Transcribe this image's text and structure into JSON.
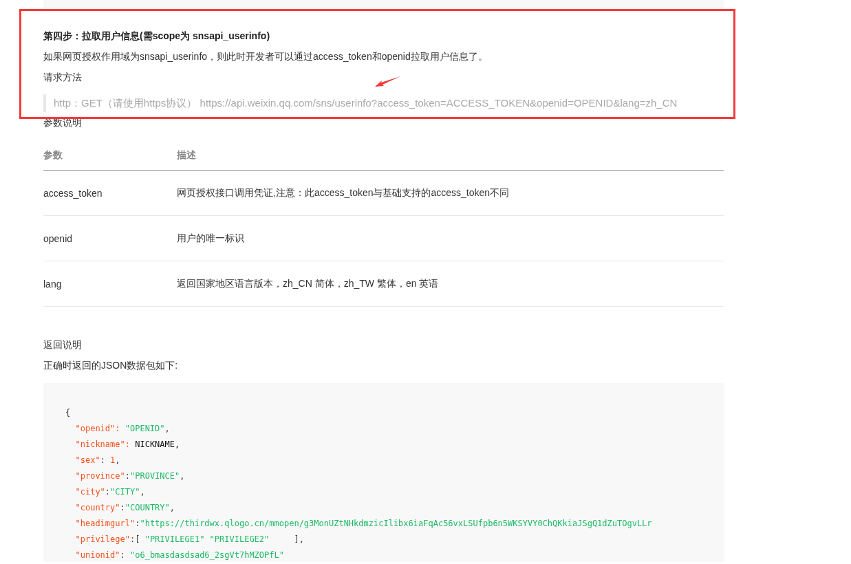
{
  "step": {
    "heading": "第四步：拉取用户信息(需scope为 snsapi_userinfo)",
    "description": "如果网页授权作用域为snsapi_userinfo，则此时开发者可以通过access_token和openid拉取用户信息了。",
    "method_label": "请求方法",
    "request": "http：GET（请使用https协议） https://api.weixin.qq.com/sns/userinfo?access_token=ACCESS_TOKEN&openid=OPENID&lang=zh_CN"
  },
  "params": {
    "title": "参数说明",
    "columns": [
      "参数",
      "描述"
    ],
    "rows": [
      [
        "access_token",
        "网页授权接口调用凭证,注意：此access_token与基础支持的access_token不同"
      ],
      [
        "openid",
        "用户的唯一标识"
      ],
      [
        "lang",
        "返回国家地区语言版本，zh_CN 简体，zh_TW 繁体，en 英语"
      ]
    ]
  },
  "response": {
    "title": "返回说明",
    "intro": "正确时返回的JSON数据包如下:",
    "code": [
      {
        "tokens": [
          {
            "kind": "punct",
            "text": "{"
          }
        ],
        "children": [
          {
            "tokens": [
              {
                "kind": "key",
                "text": "\"openid\": "
              },
              {
                "kind": "string",
                "text": "\"OPENID\""
              },
              {
                "kind": "punct",
                "text": ","
              }
            ]
          },
          {
            "tokens": [
              {
                "kind": "key",
                "text": "\"nickname\": "
              },
              {
                "kind": "plain",
                "text": "NICKNAME,"
              }
            ]
          },
          {
            "tokens": [
              {
                "kind": "key",
                "text": "\"sex\""
              },
              {
                "kind": "punct",
                "text": ": "
              },
              {
                "kind": "number",
                "text": "1"
              },
              {
                "kind": "punct",
                "text": ","
              }
            ]
          },
          {
            "tokens": [
              {
                "kind": "key",
                "text": "\"province\""
              },
              {
                "kind": "punct",
                "text": ":"
              },
              {
                "kind": "string",
                "text": "\"PROVINCE\""
              },
              {
                "kind": "punct",
                "text": ","
              }
            ]
          },
          {
            "tokens": [
              {
                "kind": "key",
                "text": "\"city\""
              },
              {
                "kind": "punct",
                "text": ":"
              },
              {
                "kind": "string",
                "text": "\"CITY\""
              },
              {
                "kind": "punct",
                "text": ","
              }
            ]
          },
          {
            "tokens": [
              {
                "kind": "key",
                "text": "\"country\""
              },
              {
                "kind": "punct",
                "text": ":"
              },
              {
                "kind": "string",
                "text": "\"COUNTRY\""
              },
              {
                "kind": "punct",
                "text": ","
              }
            ]
          },
          {
            "tokens": [
              {
                "kind": "key",
                "text": "\"headimgurl\""
              },
              {
                "kind": "punct",
                "text": ":"
              },
              {
                "kind": "string",
                "text": "\"https://thirdwx.qlogo.cn/mmopen/g3MonUZtNHkdmzicIlibx6iaFqAc56vxLSUfpb6n5WKSYVY0ChQKkiaJSgQ1dZuTOgvLLr"
              }
            ]
          },
          {
            "tokens": [
              {
                "kind": "key",
                "text": "\"privilege\""
              },
              {
                "kind": "punct",
                "text": ":[ "
              },
              {
                "kind": "string",
                "text": "\"PRIVILEGE1\" \"PRIVILEGE2\""
              },
              {
                "kind": "punct",
                "text": "     ],"
              }
            ]
          },
          {
            "tokens": [
              {
                "kind": "key",
                "text": "\"unionid\""
              },
              {
                "kind": "punct",
                "text": ": "
              },
              {
                "kind": "string",
                "text": "\"o6_bmasdasdsad6_2sgVt7hMZOPfL\""
              }
            ]
          }
        ]
      }
    ]
  }
}
